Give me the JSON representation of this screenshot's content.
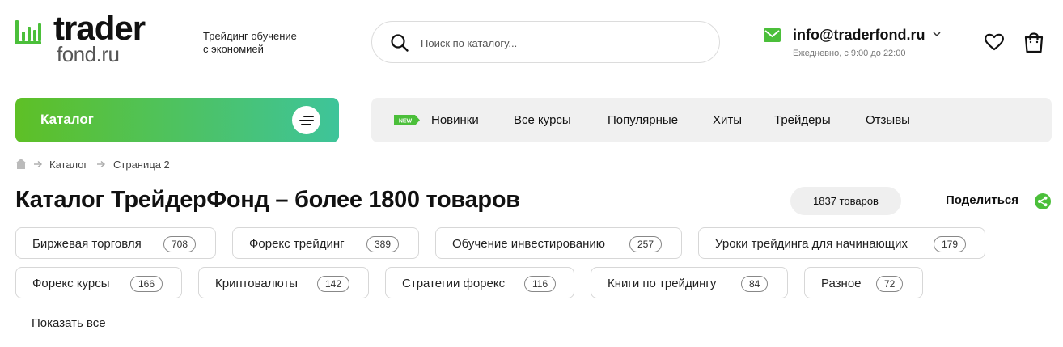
{
  "header": {
    "logo": {
      "line1": "trader",
      "line2": "fond.ru"
    },
    "tagline_line1": "Трейдинг обучение",
    "tagline_line2": "с экономией",
    "search_placeholder": "Поиск по каталогу...",
    "contact": {
      "email": "info@traderfond.ru",
      "hours": "Ежедневно, с 9:00 до 22:00"
    },
    "icons": [
      "chart-bars-icon",
      "search-icon",
      "mail-icon",
      "chevron-down-icon",
      "heart-icon",
      "bag-icon"
    ]
  },
  "nav": {
    "catalog_label": "Каталог",
    "new_badge": "NEW",
    "items": [
      "Новинки",
      "Все курсы",
      "Популярные",
      "Хиты",
      "Трейдеры",
      "Отзывы"
    ]
  },
  "breadcrumb": [
    "Каталог",
    "Страница 2"
  ],
  "main": {
    "title": "Каталог ТрейдерФонд – более 1800 товаров",
    "count": "1837 товаров",
    "share_label": "Поделиться",
    "tags": [
      {
        "label": "Биржевая торговля",
        "count": "708"
      },
      {
        "label": "Форекс трейдинг",
        "count": "389"
      },
      {
        "label": "Обучение инвестированию",
        "count": "257"
      },
      {
        "label": "Уроки трейдинга для начинающих",
        "count": "179"
      },
      {
        "label": "Форекс курсы",
        "count": "166"
      },
      {
        "label": "Криптовалюты",
        "count": "142"
      },
      {
        "label": "Стратегии форекс",
        "count": "116"
      },
      {
        "label": "Книги по трейдингу",
        "count": "84"
      },
      {
        "label": "Разное",
        "count": "72"
      }
    ],
    "show_all": "Показать все"
  },
  "colors": {
    "brand_green": "#4bbf3a",
    "gradient_start": "#5ec026",
    "gradient_end": "#3ec49a"
  }
}
